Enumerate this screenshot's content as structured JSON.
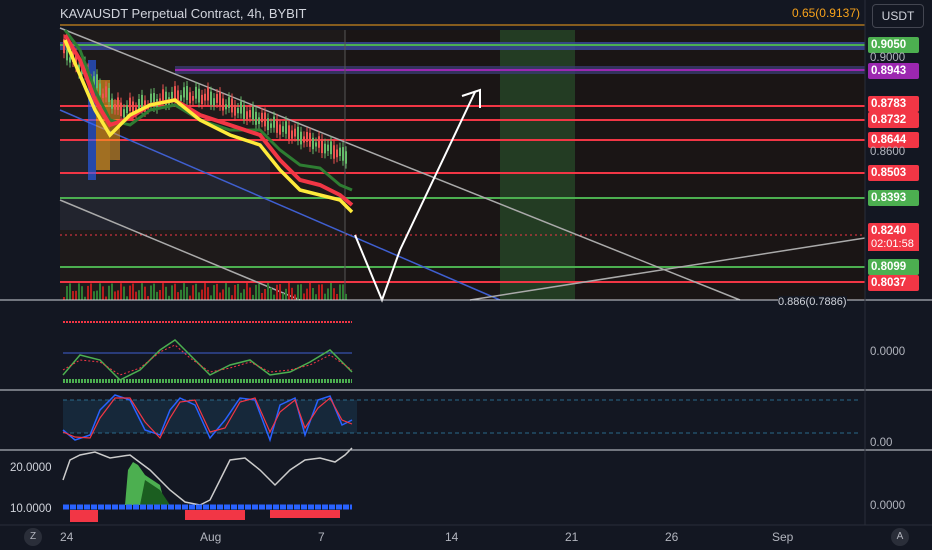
{
  "header": {
    "title": "KAVAUSDT Perpetual Contract, 4h, BYBIT"
  },
  "fib_top": "0.65(0.9137)",
  "fib_bottom": "0.886(0.7886)",
  "currency": "USDT",
  "price_labels": [
    {
      "text": "0.9050",
      "color": "#4caf50"
    },
    {
      "text": "0.9000",
      "color": "plain"
    },
    {
      "text": "0.8943",
      "color": "#9c27b0"
    },
    {
      "text": "0.8783",
      "color": "#f23645"
    },
    {
      "text": "0.8732",
      "color": "#f23645"
    },
    {
      "text": "0.8644",
      "color": "#f23645"
    },
    {
      "text": "0.8600",
      "color": "plain"
    },
    {
      "text": "0.8503",
      "color": "#f23645"
    },
    {
      "text": "0.8393",
      "color": "#4caf50"
    },
    {
      "text": "0.8240",
      "color": "#f23645"
    },
    {
      "text": "0.8099",
      "color": "#4caf50"
    },
    {
      "text": "0.8037",
      "color": "#f23645"
    }
  ],
  "countdown": "02:01:58",
  "indicator_labels": {
    "pane1": "0.0000",
    "pane2": "0.00",
    "pane3": "0.0000"
  },
  "left_labels": {
    "top": "20.0000",
    "bottom": "10.0000"
  },
  "x_axis": [
    "24",
    "Aug",
    "7",
    "14",
    "21",
    "26",
    "Sep"
  ],
  "buttons": {
    "left_corner": "Z",
    "right_corner": "A"
  },
  "colors": {
    "bg": "#131722",
    "red": "#f23645",
    "green": "#4caf50",
    "purple": "#9c27b0",
    "yellow": "#ffeb3b",
    "blue": "#2962ff"
  }
}
